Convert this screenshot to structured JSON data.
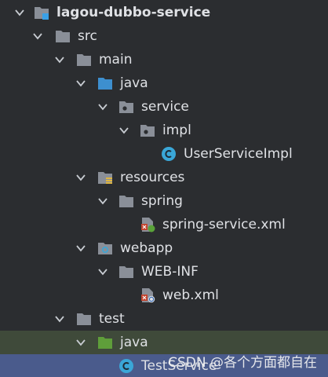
{
  "project_tree": {
    "root": "lagou-dubbo-service",
    "src": "src",
    "main": "main",
    "java_main": "java",
    "service": "service",
    "impl": "impl",
    "userServiceImpl": "UserServiceImpl",
    "resources": "resources",
    "spring": "spring",
    "spring_service_xml": "spring-service.xml",
    "webapp": "webapp",
    "web_inf": "WEB-INF",
    "web_xml": "web.xml",
    "test": "test",
    "java_test": "java",
    "testService": "TestService"
  },
  "watermark": "CSDN @各个方面都自在",
  "colors": {
    "background": "#2b2d30",
    "text": "#dfe1e5",
    "folder": "#8a8f98",
    "source_folder": "#3d8fcf",
    "test_folder": "#5f9e3a",
    "class_icon": "#3aa7d8",
    "selected_row": "#4a5b8c",
    "test_row": "#3f4a3a"
  }
}
